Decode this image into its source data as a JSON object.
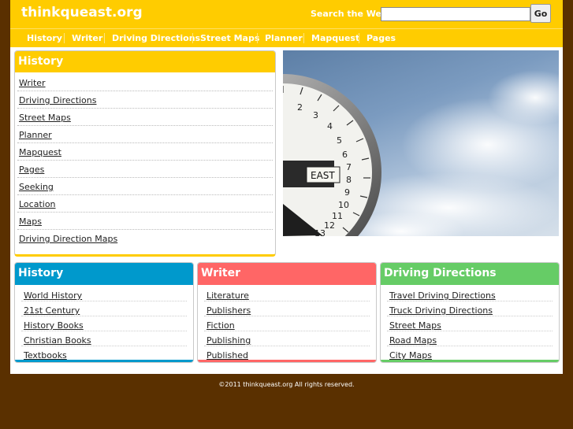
{
  "header": {
    "site_title": "thinkqueast.org",
    "search_label": "Search the Web:",
    "search_value": "",
    "go_label": "Go"
  },
  "nav": {
    "items": [
      "History",
      "Writer",
      "Driving Directions",
      "Street Maps",
      "Planner",
      "Mapquest",
      "Pages"
    ]
  },
  "main_box": {
    "title": "History",
    "links": [
      "Writer",
      "Driving Directions",
      "Street Maps",
      "Planner",
      "Mapquest",
      "Pages",
      "Seeking",
      "Location",
      "Maps",
      "Driving Direction Maps"
    ]
  },
  "hero": {
    "compass_label": "EAST",
    "dial_numbers": [
      "2",
      "3",
      "4",
      "5",
      "6",
      "7",
      "8",
      "9",
      "10",
      "11",
      "12",
      "13"
    ]
  },
  "cards": [
    {
      "title": "History",
      "color": "#0099cc",
      "links": [
        "World History",
        "21st Century",
        "History Books",
        "Christian Books",
        "Textbooks"
      ]
    },
    {
      "title": "Writer",
      "color": "#ff6666",
      "links": [
        "Literature",
        "Publishers",
        "Fiction",
        "Publishing",
        "Published"
      ]
    },
    {
      "title": "Driving Directions",
      "color": "#66cc66",
      "links": [
        "Travel Driving Directions",
        "Truck Driving Directions",
        "Street Maps",
        "Road Maps",
        "City Maps"
      ]
    }
  ],
  "colors": {
    "brand_yellow": "#ffcc00",
    "background_brown": "#5a3000"
  },
  "footer": {
    "copyright": "©2011 thinkqueast.org All rights reserved."
  }
}
